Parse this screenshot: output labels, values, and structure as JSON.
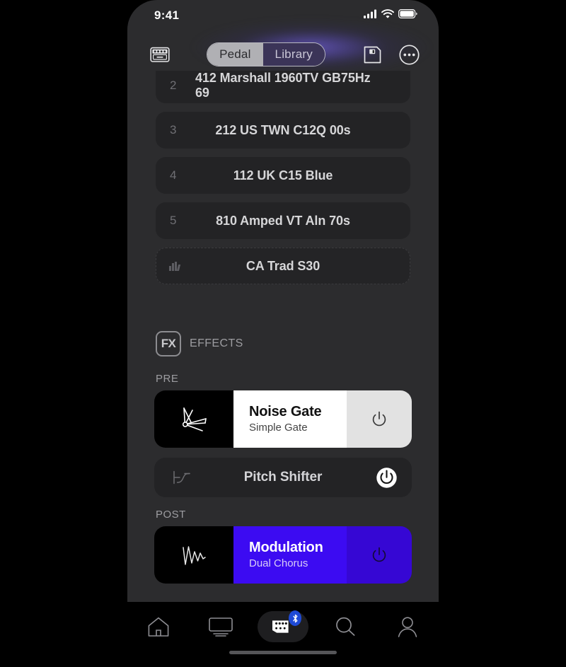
{
  "status_bar": {
    "time": "9:41",
    "signal_icon": "cellular-signal-icon",
    "wifi_icon": "wifi-icon",
    "battery_icon": "battery-icon"
  },
  "header": {
    "amp_icon": "amp-cabinet-icon",
    "save_icon": "floppy-save-icon",
    "more_icon": "more-ellipsis-icon",
    "segments": [
      {
        "label": "Pedal",
        "active": false
      },
      {
        "label": "Library",
        "active": true
      }
    ],
    "glow_color": "#6d5cd6"
  },
  "cabinet_list": {
    "rows": [
      {
        "index": "2",
        "name": "412 Marshall 1960TV GB75Hz 69",
        "icon": null,
        "dashed": false,
        "partial": true
      },
      {
        "index": "3",
        "name": "212 US TWN C12Q 00s",
        "icon": null,
        "dashed": false,
        "partial": false
      },
      {
        "index": "4",
        "name": "112 UK C15 Blue",
        "icon": null,
        "dashed": false,
        "partial": false
      },
      {
        "index": "5",
        "name": "810 Amped VT Aln 70s",
        "icon": null,
        "dashed": false,
        "partial": false
      },
      {
        "index": null,
        "name": "CA Trad S30",
        "icon": "levels-bars-icon",
        "dashed": true,
        "partial": false
      }
    ]
  },
  "effects": {
    "badge_label": "FX",
    "badge_icon": "fx-badge-icon",
    "section_title": "EFFECTS",
    "groups": [
      {
        "label": "PRE",
        "items": [
          {
            "style": "card",
            "name": "Noise Gate",
            "subtitle": "Simple Gate",
            "icon": "noise-gate-burst-icon",
            "power_icon": "power-icon",
            "enabled": true,
            "accent": "#ffffff"
          },
          {
            "style": "pill",
            "name": "Pitch Shifter",
            "subtitle": null,
            "icon": "pitch-curve-icon",
            "power_icon": "power-icon",
            "enabled": true,
            "accent": "#232325"
          }
        ]
      },
      {
        "label": "POST",
        "items": [
          {
            "style": "card",
            "name": "Modulation",
            "subtitle": "Dual Chorus",
            "icon": "modulation-wave-icon",
            "power_icon": "power-icon",
            "enabled": true,
            "accent": "#3c0bf2"
          }
        ]
      }
    ]
  },
  "tab_bar": {
    "tabs": [
      {
        "name": "home",
        "icon": "home-icon",
        "active": false,
        "badge": null
      },
      {
        "name": "display",
        "icon": "monitor-icon",
        "active": false,
        "badge": null
      },
      {
        "name": "amp",
        "icon": "amp-device-icon",
        "active": true,
        "badge": "bluetooth-icon"
      },
      {
        "name": "search",
        "icon": "search-icon",
        "active": false,
        "badge": null
      },
      {
        "name": "profile",
        "icon": "person-icon",
        "active": false,
        "badge": null
      }
    ],
    "badge_color": "#1e4ad6"
  }
}
